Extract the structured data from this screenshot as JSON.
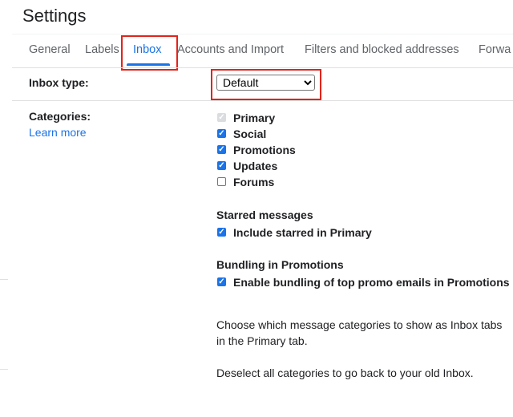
{
  "title": "Settings",
  "tabs": [
    {
      "label": "General"
    },
    {
      "label": "Labels"
    },
    {
      "label": "Inbox",
      "active": true
    },
    {
      "label": "Accounts and Import"
    },
    {
      "label": "Filters and blocked addresses"
    },
    {
      "label": "Forwa"
    }
  ],
  "inbox_type": {
    "label": "Inbox type:",
    "selected": "Default"
  },
  "categories": {
    "label": "Categories:",
    "learn_more": "Learn more",
    "items": [
      {
        "label": "Primary",
        "checked": true,
        "disabled": true
      },
      {
        "label": "Social",
        "checked": true
      },
      {
        "label": "Promotions",
        "checked": true
      },
      {
        "label": "Updates",
        "checked": true
      },
      {
        "label": "Forums",
        "checked": false
      }
    ]
  },
  "starred": {
    "heading": "Starred messages",
    "option": "Include starred in Primary",
    "checked": true
  },
  "bundling": {
    "heading": "Bundling in Promotions",
    "option": "Enable bundling of top promo emails in Promotions",
    "checked": true
  },
  "help": {
    "line1": "Choose which message categories to show as Inbox tabs",
    "line2": "in the Primary tab.",
    "line3": "Deselect all categories to go back to your old Inbox."
  },
  "colors": {
    "accent": "#1a73e8",
    "highlight": "#e2231a"
  }
}
